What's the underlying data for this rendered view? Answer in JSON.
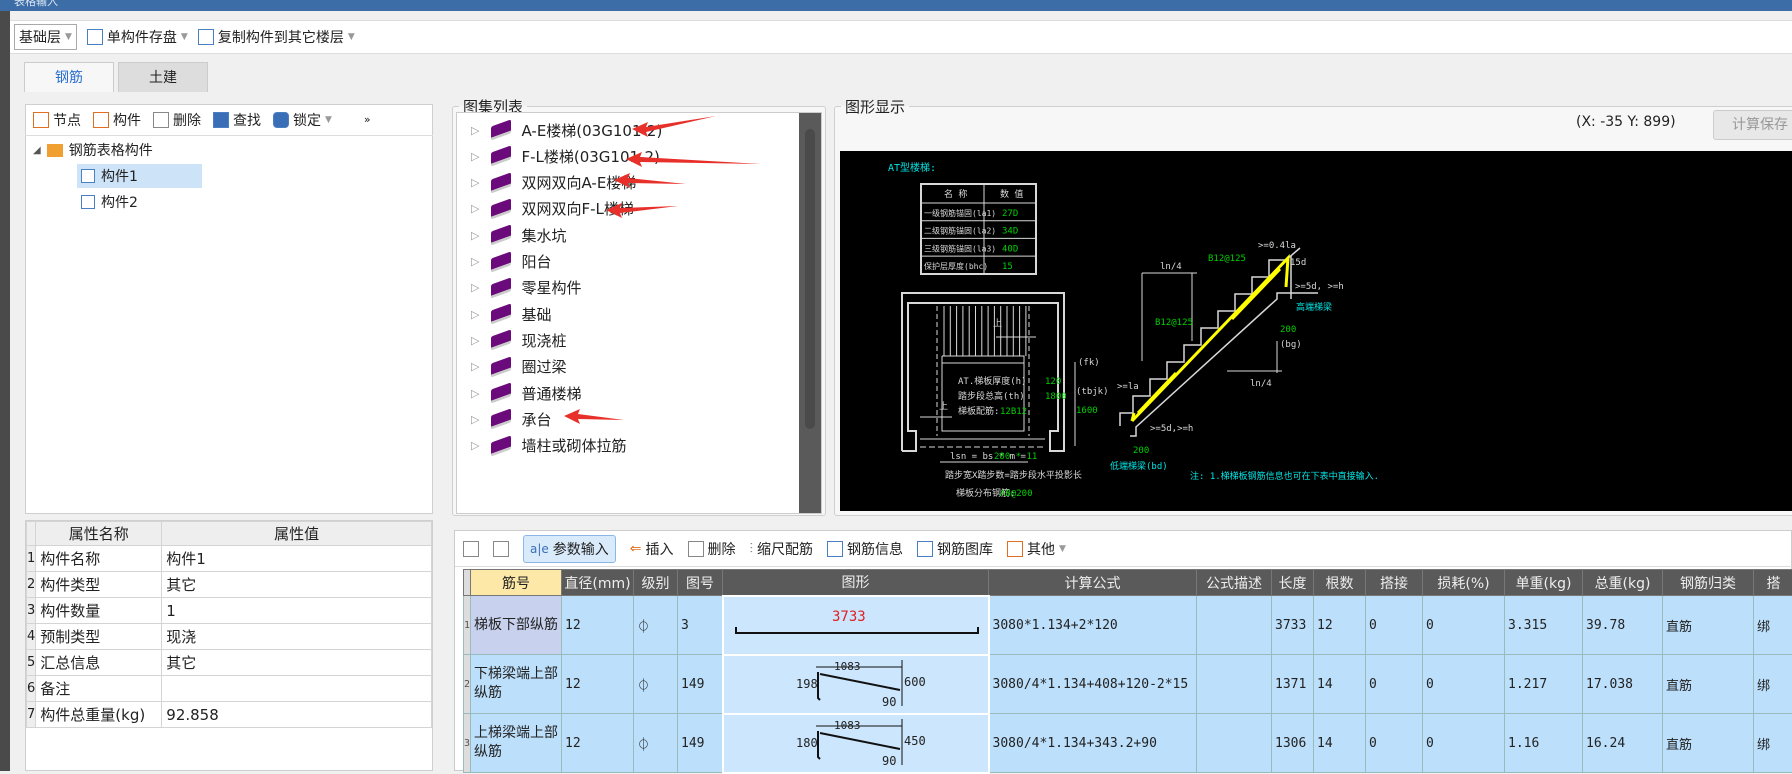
{
  "window": {
    "title": "表格输入"
  },
  "toolbar": {
    "floor": "基础层",
    "save_single": "单构件存盘",
    "copy_to_floor": "复制构件到其它楼层"
  },
  "tabs": [
    {
      "label": "钢筋"
    },
    {
      "label": "土建"
    }
  ],
  "tree_toolbar": {
    "node": "节点",
    "component": "构件",
    "delete": "删除",
    "find": "查找",
    "lock": "锁定",
    "more": "»"
  },
  "tree": {
    "root": "钢筋表格构件",
    "children": [
      {
        "label": "构件1",
        "selected": true
      },
      {
        "label": "构件2",
        "selected": false
      }
    ]
  },
  "properties": {
    "headers": [
      "属性名称",
      "属性值"
    ],
    "rows": [
      {
        "n": "1",
        "name": "构件名称",
        "value": "构件1"
      },
      {
        "n": "2",
        "name": "构件类型",
        "value": "其它"
      },
      {
        "n": "3",
        "name": "构件数量",
        "value": "1"
      },
      {
        "n": "4",
        "name": "预制类型",
        "value": "现浇"
      },
      {
        "n": "5",
        "name": "汇总信息",
        "value": "其它"
      },
      {
        "n": "6",
        "name": "备注",
        "value": ""
      },
      {
        "n": "7",
        "name": "构件总重量(kg)",
        "value": "92.858"
      }
    ]
  },
  "atlas": {
    "title": "图集列表",
    "items": [
      "A-E楼梯(03G101-2)",
      "F-L楼梯(03G101-2)",
      "双网双向A-E楼梯",
      "双网双向F-L楼梯",
      "集水坑",
      "阳台",
      "零星构件",
      "基础",
      "现浇桩",
      "圈过梁",
      "普通楼梯",
      "承台",
      "墙柱或砌体拉筋"
    ],
    "arrow_color": "#e8302a"
  },
  "graphic": {
    "title": "图形显示",
    "coords": "(X: -35 Y: 899)",
    "calc_save": "计算保存",
    "drawing": {
      "heading": "AT型楼梯:",
      "table_headers": [
        "名 称",
        "数 值"
      ],
      "table_rows": [
        [
          "一级钢筋锚固(la1)",
          "27D"
        ],
        [
          "二级钢筋锚固(la2)",
          "34D"
        ],
        [
          "三级钢筋锚固(la3)",
          "40D"
        ],
        [
          "保护层厚度(bhc)",
          "15"
        ]
      ],
      "thick": "AT.梯板厚度(h)",
      "thick_v": "120",
      "height": "踏步段总高(th)",
      "height_v": "1800",
      "rebar": "梯板配筋:",
      "rebar_v": "12B12",
      "fk": "(fk)",
      "tbjk": "(tbjk)",
      "w1600": "1600",
      "up": "上",
      "lsn": "lsn = bs * m =",
      "lsn_v": "280 * 11",
      "lsn_desc": "踏步宽X踏步数=踏步段水平投影长",
      "dist": "梯板分布钢筋:",
      "dist_v": "A8@200",
      "ln4": "ln/4",
      "b12_top": "B12@125",
      "b12_low": "B12@125",
      "la04": ">=0.4la",
      "d15": "15d",
      "d5h_top": ">=5d, >=h",
      "high_beam": "高端梯梁",
      "w200_top": "200",
      "bg": "(bg)",
      "la": ">=la",
      "d5h_low": ">=5d,>=h",
      "w200_low": "200",
      "low_beam": "低端梯梁(bd)",
      "note": "注: 1.梯梯板钢筋信息也可在下表中直接输入.",
      "colors": {
        "cyan": "#00e5e5",
        "green": "#00d000",
        "yellow": "#ffff00",
        "white": "#d8d8d8"
      }
    }
  },
  "bottom_toolbar": {
    "param_input": "参数输入",
    "insert": "插入",
    "delete": "删除",
    "scale": "缩尺配筋",
    "rebar_info": "钢筋信息",
    "rebar_lib": "钢筋图库",
    "other": "其他"
  },
  "grid": {
    "headers": [
      "筋号",
      "直径(mm)",
      "级别",
      "图号",
      "图形",
      "计算公式",
      "公式描述",
      "长度",
      "根数",
      "搭接",
      "损耗(%)",
      "单重(kg)",
      "总重(kg)",
      "钢筋归类",
      "搭"
    ],
    "rows": [
      {
        "n": "1",
        "name": "梯板下部纵筋",
        "dia": "12",
        "grade": "⏀",
        "fig": "3",
        "shape": {
          "len": "3733"
        },
        "formula": "3080*1.134+2*120",
        "desc": "",
        "length": "3733",
        "count": "12",
        "lap": "0",
        "loss": "0",
        "unit": "3.315",
        "total": "39.78",
        "cls": "直筋",
        "lapt": "绑"
      },
      {
        "n": "2",
        "name": "下梯梁端上部纵筋",
        "dia": "12",
        "grade": "⏀",
        "fig": "149",
        "shape": {
          "top": "1083",
          "left": "198",
          "right": "600",
          "bottom": "90"
        },
        "formula": "3080/4*1.134+408+120-2*15",
        "desc": "",
        "length": "1371",
        "count": "14",
        "lap": "0",
        "loss": "0",
        "unit": "1.217",
        "total": "17.038",
        "cls": "直筋",
        "lapt": "绑"
      },
      {
        "n": "3",
        "name": "上梯梁端上部纵筋",
        "dia": "12",
        "grade": "⏀",
        "fig": "149",
        "shape": {
          "top": "1083",
          "left": "180",
          "right": "450",
          "bottom": "90"
        },
        "formula": "3080/4*1.134+343.2+90",
        "desc": "",
        "length": "1306",
        "count": "14",
        "lap": "0",
        "loss": "0",
        "unit": "1.16",
        "total": "16.24",
        "cls": "直筋",
        "lapt": "绑"
      }
    ]
  }
}
